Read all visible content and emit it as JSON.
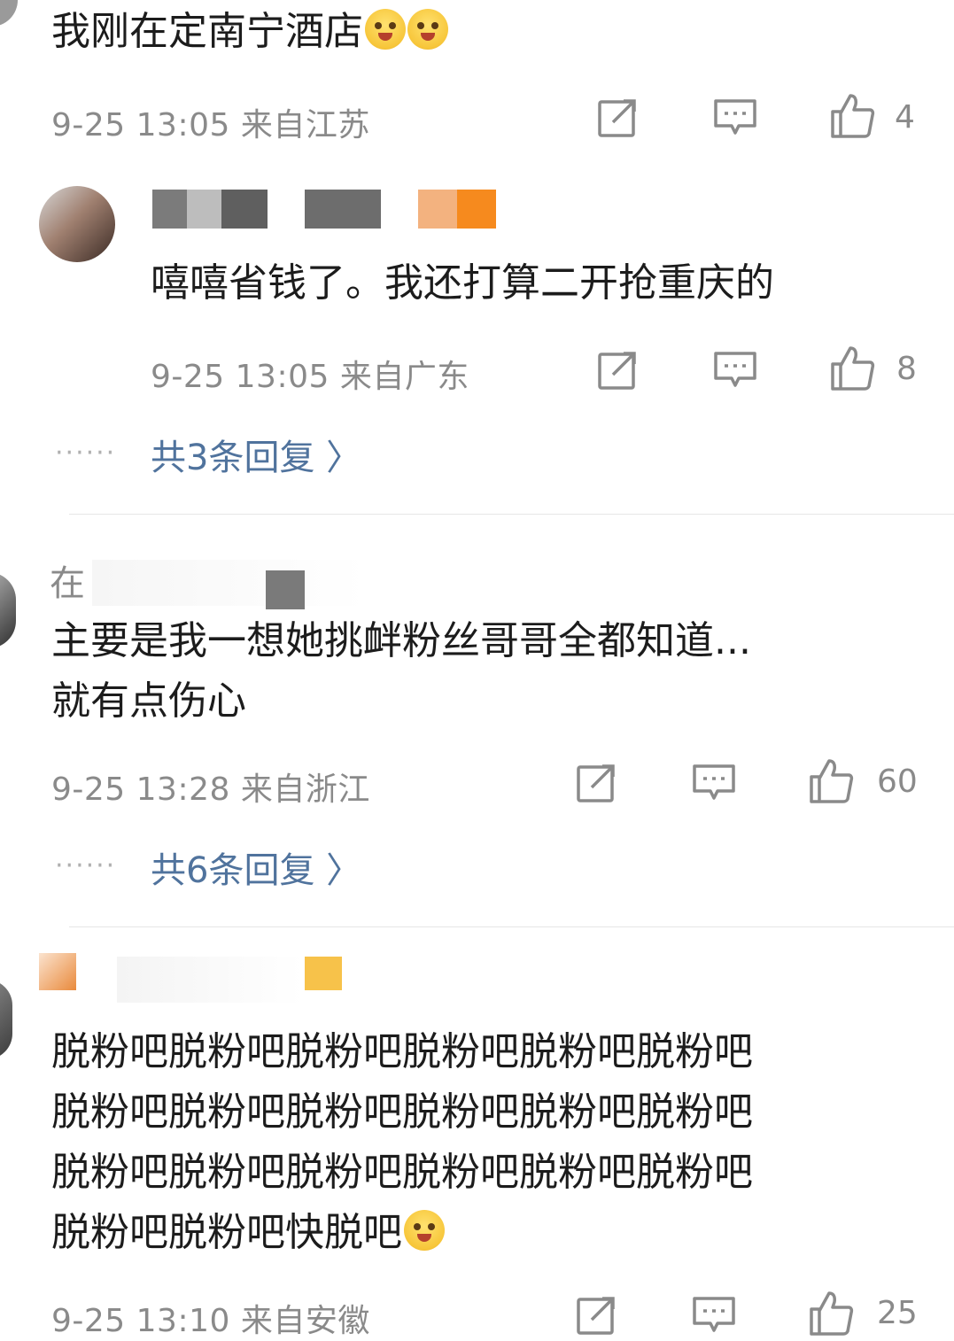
{
  "comments": [
    {
      "text": "我刚在定南宁酒店",
      "time": "9-25 13:05",
      "location": "来自江苏",
      "likes": "4"
    },
    {
      "text": "嘻嘻省钱了。我还打算二开抢重庆的",
      "time": "9-25 13:05",
      "location": "来自广东",
      "likes": "8",
      "dots": "······",
      "replies": "共3条回复 〉"
    },
    {
      "username_partial": "在",
      "text_line1": "主要是我一想她挑衅粉丝哥哥全都知道...",
      "text_line2": "就有点伤心",
      "time": "9-25 13:28",
      "location": "来自浙江",
      "likes": "60",
      "dots": "······",
      "replies": "共6条回复 〉"
    },
    {
      "text_line1": "脱粉吧脱粉吧脱粉吧脱粉吧脱粉吧脱粉吧",
      "text_line2": "脱粉吧脱粉吧脱粉吧脱粉吧脱粉吧脱粉吧",
      "text_line3": "脱粉吧脱粉吧脱粉吧脱粉吧脱粉吧脱粉吧",
      "text_line4": "脱粉吧脱粉吧快脱吧",
      "time": "9-25 13:10",
      "location": "来自安徽",
      "likes": "25"
    }
  ],
  "icons": {
    "share": "share-icon",
    "comment": "comment-icon",
    "like": "thumbs-up-icon"
  },
  "colors": {
    "reply_link": "#50739d",
    "meta": "#8a8a8a"
  }
}
